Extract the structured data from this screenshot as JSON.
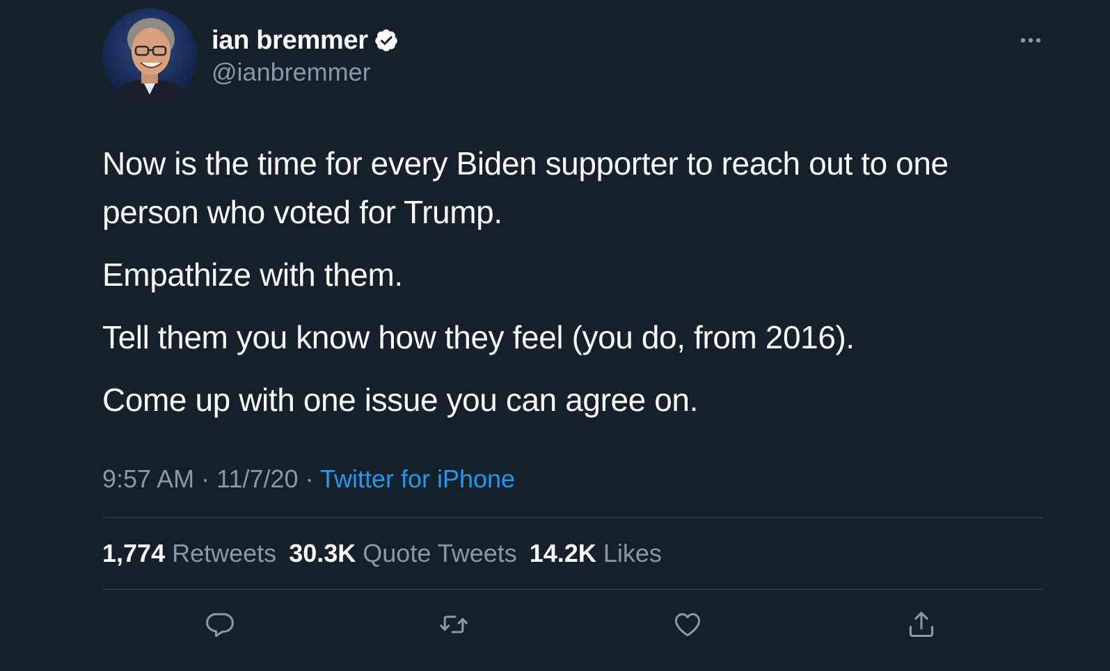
{
  "author": {
    "display_name": "ian bremmer",
    "handle": "@ianbremmer",
    "verified": true
  },
  "tweet": {
    "paragraphs": [
      "Now is the time for every Biden supporter to reach out to one person who voted for Trump.",
      "Empathize with them.",
      "Tell them you know how they feel (you do, from 2016).",
      "Come up with one issue you can agree on."
    ],
    "time": "9:57 AM",
    "date": "11/7/20",
    "separator": "·",
    "source": "Twitter for iPhone"
  },
  "stats": {
    "retweets_count": "1,774",
    "retweets_label": "Retweets",
    "quote_tweets_count": "30.3K",
    "quote_tweets_label": "Quote Tweets",
    "likes_count": "14.2K",
    "likes_label": "Likes"
  },
  "actions": [
    "reply-icon",
    "retweet-icon",
    "like-icon",
    "share-icon"
  ],
  "colors": {
    "background": "#15202b",
    "text": "#ffffff",
    "secondary": "#8b98a5",
    "link": "#1d9bf0",
    "divider": "#38444d"
  }
}
